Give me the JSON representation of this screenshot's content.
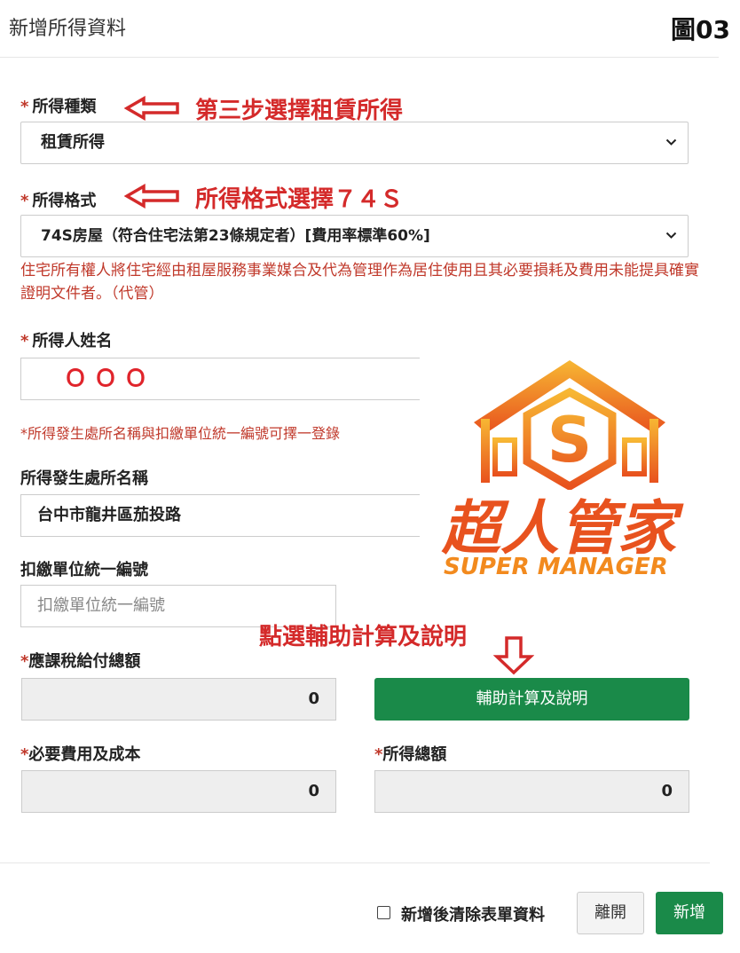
{
  "header": {
    "title": "新增所得資料",
    "figure_no": "圖03"
  },
  "form": {
    "income_type": {
      "label": "所得種類",
      "value": "租賃所得"
    },
    "income_format": {
      "label": "所得格式",
      "value": "74S房屋（符合住宅法第23條規定者）[費用率標準60%]"
    },
    "format_note": "住宅所有權人將住宅經由租屋服務事業媒合及代為管理作為居住使用且其必要損耗及費用未能提具確實證明文件者。（代管）",
    "payee_name": {
      "label": "所得人姓名",
      "value": "ＯＯＯ"
    },
    "source_note": "*所得發生處所名稱與扣繳單位統一編號可擇一登錄",
    "payer_name": {
      "label": "所得發生處所名稱",
      "value": "台中市龍井區茄投路"
    },
    "payer_id": {
      "label": "扣繳單位統一編號",
      "placeholder": "扣繳單位統一編號"
    },
    "gross_payment": {
      "label": "應課稅給付總額",
      "value": "0"
    },
    "assist_button": "輔助計算及說明",
    "expenses": {
      "label": "必要費用及成本",
      "value": "0"
    },
    "total_income": {
      "label": "所得總額",
      "value": "0"
    }
  },
  "annotations": {
    "step3": "第三步選擇租賃所得",
    "format_hint": "所得格式選擇７４Ｓ",
    "click_hint": "點選輔助計算及說明"
  },
  "logo": {
    "text_cn": "超人管家",
    "text_en": "SUPER MANAGER"
  },
  "footer": {
    "clear_checkbox_label": "新增後清除表單資料",
    "leave_button": "離開",
    "add_button": "新增"
  },
  "colors": {
    "accent_green": "#1a8a49",
    "annotation_red": "#d42a2a",
    "required_red": "#c0392b",
    "logo_orange": "#f28a1e"
  }
}
